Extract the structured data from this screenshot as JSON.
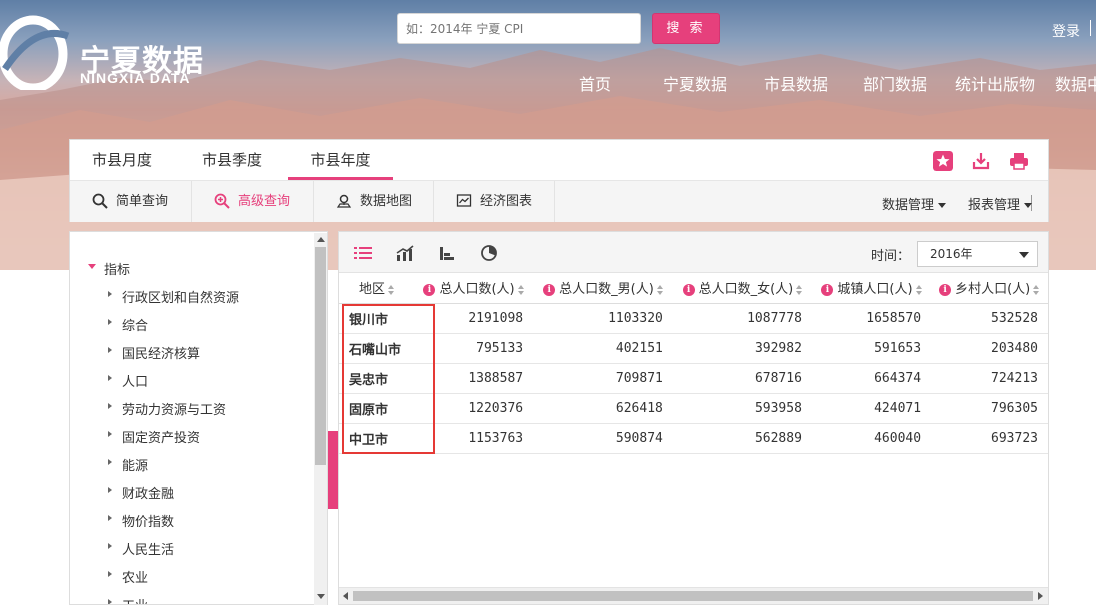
{
  "brand": {
    "name_cn": "宁夏数据",
    "name_en": "NINGXIA DATA"
  },
  "search": {
    "placeholder": "如：2014年 宁夏 CPI",
    "button_label": "搜 索"
  },
  "header": {
    "login_label": "登录"
  },
  "main_nav": [
    "首页",
    "宁夏数据",
    "市县数据",
    "部门数据",
    "统计出版物",
    "数据中"
  ],
  "period_tabs": [
    "市县月度",
    "市县季度",
    "市县年度"
  ],
  "active_period_tab": "市县年度",
  "toolbar": {
    "tools": [
      "简单查询",
      "高级查询",
      "数据地图",
      "经济图表"
    ],
    "active_tool": "高级查询",
    "data_management": "数据管理",
    "report_management": "报表管理"
  },
  "sidebar": {
    "root_label": "指标",
    "items": [
      "行政区划和自然资源",
      "综合",
      "国民经济核算",
      "人口",
      "劳动力资源与工资",
      "固定资产投资",
      "能源",
      "财政金融",
      "物价指数",
      "人民生活",
      "农业",
      "工业"
    ]
  },
  "data_panel": {
    "time_label": "时间：",
    "selected_year": "2016年"
  },
  "table": {
    "columns": [
      "地区",
      "总人口数(人)",
      "总人口数_男(人)",
      "总人口数_女(人)",
      "城镇人口(人)",
      "乡村人口(人)"
    ],
    "rows": [
      [
        "银川市",
        "2191098",
        "1103320",
        "1087778",
        "1658570",
        "532528"
      ],
      [
        "石嘴山市",
        "795133",
        "402151",
        "392982",
        "591653",
        "203480"
      ],
      [
        "吴忠市",
        "1388587",
        "709871",
        "678716",
        "664374",
        "724213"
      ],
      [
        "固原市",
        "1220376",
        "626418",
        "593958",
        "424071",
        "796305"
      ],
      [
        "中卫市",
        "1153763",
        "590874",
        "562889",
        "460040",
        "693723"
      ]
    ]
  },
  "colors": {
    "accent": "#e6407c",
    "highlight_box": "#e53935"
  }
}
